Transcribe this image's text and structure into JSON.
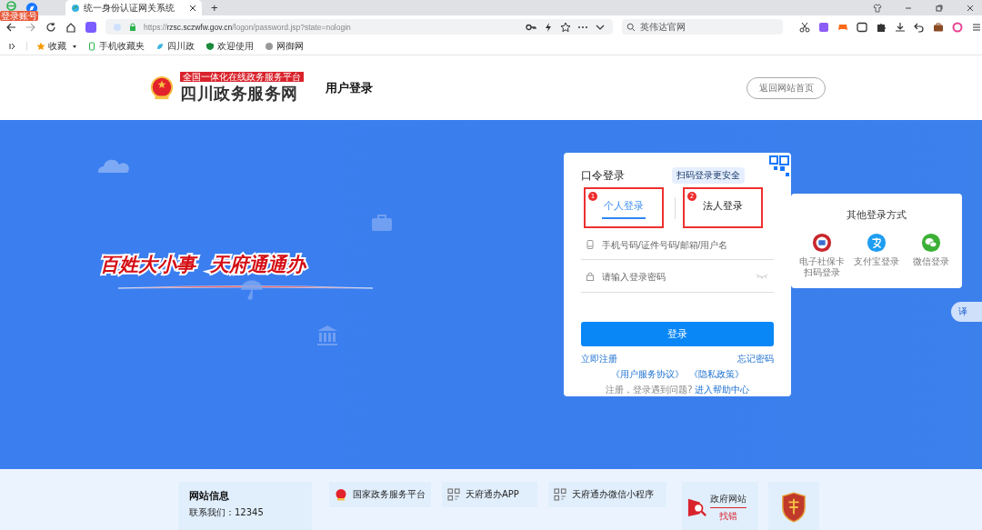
{
  "browser": {
    "logo_badge": "登录账号",
    "tab_title": "统一身份认证网关系统",
    "new_tab": "+",
    "url_scheme": "https://",
    "url_host": "rzsc.sczwfw.gov.cn",
    "url_path": "/logon/password.jsp?state=nologin",
    "search_placeholder": "英伟达官网",
    "bookmarks": [
      {
        "kind": "star",
        "label": "收藏"
      },
      {
        "kind": "phone",
        "label": "手机收藏夹"
      },
      {
        "kind": "leaf",
        "label": "四川政"
      },
      {
        "kind": "shield",
        "label": "欢迎使用"
      },
      {
        "kind": "globe",
        "label": "网御网"
      }
    ]
  },
  "site": {
    "platform_tag": "全国一体化在线政务服务平台",
    "name": "四川政务服务网",
    "page_title": "用户登录",
    "home_button": "返回网站首页"
  },
  "banner": {
    "slogan": [
      "百姓大小事",
      "天府通通办"
    ]
  },
  "login": {
    "title": "口令登录",
    "qr_hint": "扫码登录更安全",
    "tabs": [
      {
        "label": "个人登录",
        "selected": true,
        "marker": "1"
      },
      {
        "label": "法人登录",
        "selected": false,
        "marker": "2"
      }
    ],
    "fields": [
      {
        "kind": "account",
        "placeholder": "手机号码/证件号码/邮箱/用户名"
      },
      {
        "kind": "password",
        "placeholder": "请输入登录密码"
      }
    ],
    "submit": "登录",
    "register": "立即注册",
    "forgot": "忘记密码",
    "agreements": [
      "《用户服务协议》",
      "《隐私政策》"
    ],
    "help_text": "注册，登录遇到问题?",
    "help_link": "进入帮助中心"
  },
  "other_login": {
    "title": "其他登录方式",
    "methods": [
      {
        "kind": "social-card",
        "label": "电子社保卡扫码登录"
      },
      {
        "kind": "alipay",
        "label": "支付宝登录"
      },
      {
        "kind": "wechat",
        "label": "微信登录"
      }
    ]
  },
  "translate_button": "译",
  "footer": {
    "info_title": "网站信息",
    "info_items": [
      "联系我们：12345"
    ],
    "links": [
      {
        "kind": "emblem",
        "label": "国家政务服务平台"
      },
      {
        "kind": "qr",
        "label": "天府通办APP"
      },
      {
        "kind": "qr",
        "label": "天府通办微信小程序"
      }
    ],
    "report": {
      "title": "政府网站",
      "subtitle": "找错"
    }
  }
}
